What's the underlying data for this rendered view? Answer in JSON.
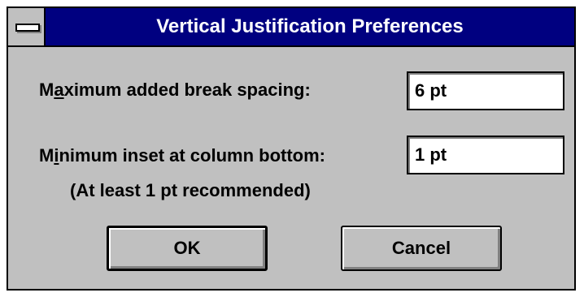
{
  "window": {
    "title": "Vertical Justification Preferences"
  },
  "fields": {
    "max_break_spacing": {
      "label_before": "M",
      "label_mnemonic": "a",
      "label_after": "ximum added break spacing:",
      "value": "6 pt"
    },
    "min_inset": {
      "label_before": "M",
      "label_mnemonic": "i",
      "label_after": "nimum inset at column bottom:",
      "value": "1 pt",
      "note": "(At least 1 pt recommended)"
    }
  },
  "buttons": {
    "ok_label": "OK",
    "cancel_label": "Cancel"
  },
  "icons": {
    "system_menu": "system-menu-icon"
  },
  "colors": {
    "titlebar": "#000080",
    "face": "#c0c0c0",
    "title_text": "#ffffff"
  }
}
